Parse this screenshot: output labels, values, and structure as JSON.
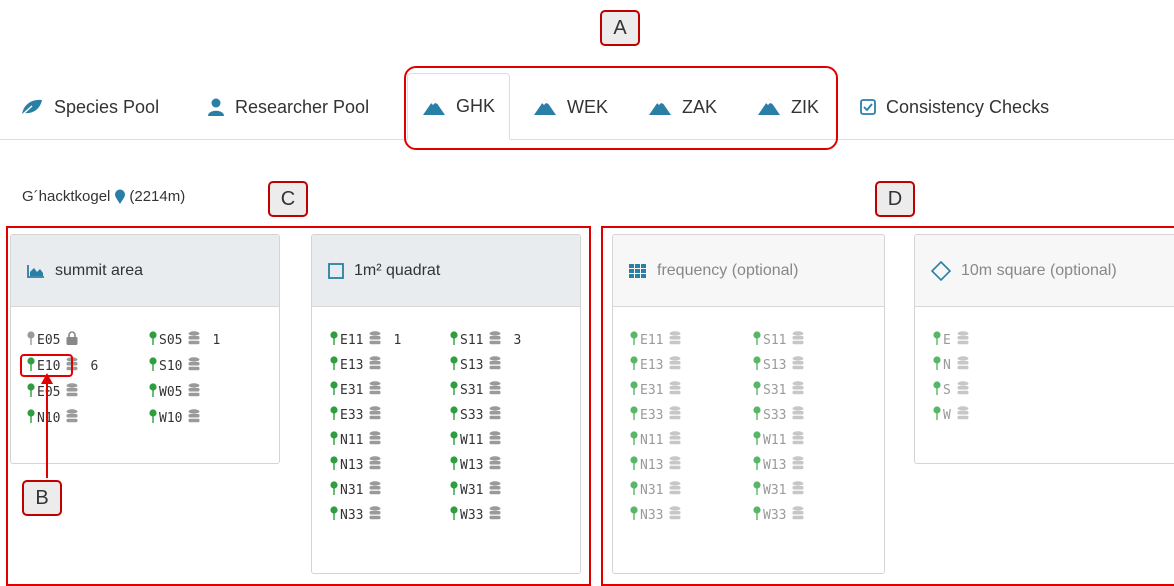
{
  "nav": {
    "items": [
      {
        "label": "Species Pool",
        "icon": "leaf-icon"
      },
      {
        "label": "Researcher Pool",
        "icon": "user-icon"
      },
      {
        "label": "GHK",
        "icon": "mountain-icon"
      },
      {
        "label": "WEK",
        "icon": "mountain-icon"
      },
      {
        "label": "ZAK",
        "icon": "mountain-icon"
      },
      {
        "label": "ZIK",
        "icon": "mountain-icon"
      },
      {
        "label": "Consistency Checks",
        "icon": "checkbox-icon"
      }
    ],
    "active": "GHK"
  },
  "summit": {
    "name": "G´hacktkogel",
    "elevation": "(2214m)"
  },
  "callouts": {
    "a": "A",
    "b": "B",
    "c": "C",
    "d": "D"
  },
  "cards": {
    "summit_area": {
      "title": "summit area",
      "plots": [
        {
          "code": "E05",
          "state": "locked",
          "count": ""
        },
        {
          "code": "E10",
          "state": "active",
          "count": "6"
        },
        {
          "code": "E05",
          "state": "active",
          "count": ""
        },
        {
          "code": "N10",
          "state": "active",
          "count": ""
        },
        {
          "code": "S05",
          "state": "active",
          "count": "1"
        },
        {
          "code": "S10",
          "state": "active",
          "count": ""
        },
        {
          "code": "W05",
          "state": "active",
          "count": ""
        },
        {
          "code": "W10",
          "state": "active",
          "count": ""
        }
      ]
    },
    "quadrat": {
      "title": "1m² quadrat",
      "plots": [
        {
          "code": "E11",
          "count": "1"
        },
        {
          "code": "E13",
          "count": ""
        },
        {
          "code": "E31",
          "count": ""
        },
        {
          "code": "E33",
          "count": ""
        },
        {
          "code": "N11",
          "count": ""
        },
        {
          "code": "N13",
          "count": ""
        },
        {
          "code": "N31",
          "count": ""
        },
        {
          "code": "N33",
          "count": ""
        },
        {
          "code": "S11",
          "count": "3"
        },
        {
          "code": "S13",
          "count": ""
        },
        {
          "code": "S31",
          "count": ""
        },
        {
          "code": "S33",
          "count": ""
        },
        {
          "code": "W11",
          "count": ""
        },
        {
          "code": "W13",
          "count": ""
        },
        {
          "code": "W31",
          "count": ""
        },
        {
          "code": "W33",
          "count": ""
        }
      ]
    },
    "frequency": {
      "title": "frequency (optional)",
      "plots": [
        "E11",
        "E13",
        "E31",
        "E33",
        "N11",
        "N13",
        "N31",
        "N33",
        "S11",
        "S13",
        "S31",
        "S33",
        "W11",
        "W13",
        "W31",
        "W33"
      ]
    },
    "square10": {
      "title": "10m square (optional)",
      "plots": [
        "E",
        "N",
        "S",
        "W"
      ]
    }
  },
  "colors": {
    "accent": "#2a7fa6",
    "pin_green": "#2e9e3e",
    "annotation_red": "#e00000"
  }
}
